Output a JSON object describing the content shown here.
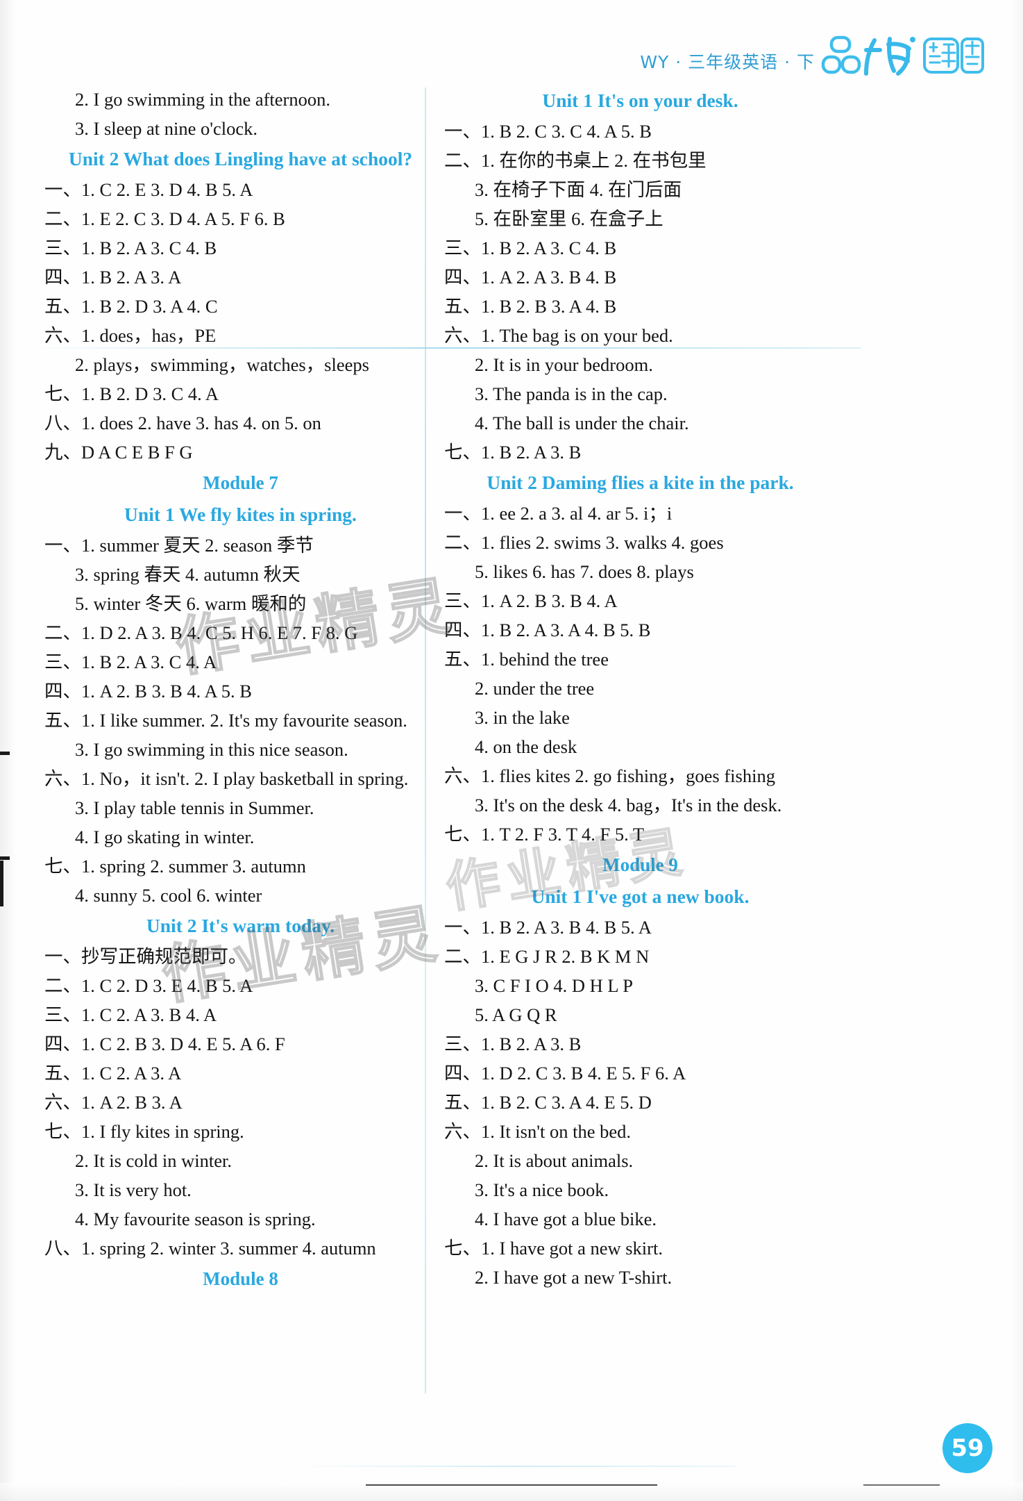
{
  "header": {
    "subject_line": "WY · 三年级英语 · 下",
    "logo_text": "品优课堂",
    "logo_part1": "品",
    "logo_part2": "优",
    "logo_part3": "课",
    "logo_part4": "堂",
    "accent_color": "#29a8e0"
  },
  "watermark": {
    "text": "作业精灵"
  },
  "page_number": "59",
  "left_column": [
    {
      "type": "answer",
      "indent": 1,
      "text": "2. I go swimming in the afternoon."
    },
    {
      "type": "answer",
      "indent": 1,
      "text": "3. I sleep at nine o'clock."
    },
    {
      "type": "unit",
      "text": "Unit 2    What does Lingling have at school?"
    },
    {
      "type": "answer",
      "indent": 0,
      "text": "一、1. C   2. E   3. D   4. B   5. A"
    },
    {
      "type": "answer",
      "indent": 0,
      "text": "二、1. E   2. C   3. D   4. A   5. F   6. B"
    },
    {
      "type": "answer",
      "indent": 0,
      "text": "三、1. B   2. A   3. C   4. B"
    },
    {
      "type": "answer",
      "indent": 0,
      "text": "四、1. B   2. A   3. A"
    },
    {
      "type": "answer",
      "indent": 0,
      "text": "五、1. B   2. D   3. A   4. C"
    },
    {
      "type": "answer",
      "indent": 0,
      "text": "六、1. does，has，PE"
    },
    {
      "type": "answer",
      "indent": 1,
      "text": "2. plays，swimming，watches，sleeps"
    },
    {
      "type": "answer",
      "indent": 0,
      "text": "七、1. B   2. D   3. C   4. A"
    },
    {
      "type": "answer",
      "indent": 0,
      "text": "八、1. does   2. have   3. has   4. on   5. on"
    },
    {
      "type": "answer",
      "indent": 0,
      "text": "九、D   A   C   E   B   F   G"
    },
    {
      "type": "module",
      "text": "Module 7"
    },
    {
      "type": "unit",
      "text": "Unit 1    We fly kites in spring."
    },
    {
      "type": "answer",
      "indent": 0,
      "text": "一、1. summer   夏天   2. season   季节"
    },
    {
      "type": "answer",
      "indent": 1,
      "text": "3. spring   春天   4. autumn   秋天"
    },
    {
      "type": "answer",
      "indent": 1,
      "text": "5. winter   冬天   6. warm   暖和的"
    },
    {
      "type": "answer",
      "indent": 0,
      "text": "二、1. D  2. A  3. B  4. C  5. H  6. E  7. F  8. G"
    },
    {
      "type": "answer",
      "indent": 0,
      "text": "三、1. B   2. A   3. C   4. A"
    },
    {
      "type": "answer",
      "indent": 0,
      "text": "四、1. A   2. B   3. B   4. A   5. B"
    },
    {
      "type": "answer",
      "indent": 0,
      "text": "五、1. I like summer.    2. It's my favourite season."
    },
    {
      "type": "answer",
      "indent": 1,
      "text": "3. I go swimming in this nice season."
    },
    {
      "type": "answer",
      "indent": 0,
      "text": "六、1. No，it isn't.    2. I play basketball in spring."
    },
    {
      "type": "answer",
      "indent": 1,
      "text": "3. I play table tennis in Summer."
    },
    {
      "type": "answer",
      "indent": 1,
      "text": "4. I go skating in winter."
    },
    {
      "type": "answer",
      "indent": 0,
      "text": "七、1. spring   2. summer   3. autumn"
    },
    {
      "type": "answer",
      "indent": 1,
      "text": "4. sunny   5. cool   6. winter"
    },
    {
      "type": "unit",
      "text": "Unit 2    It's warm today."
    },
    {
      "type": "answer",
      "indent": 0,
      "text": "一、抄写正确规范即可。"
    },
    {
      "type": "answer",
      "indent": 0,
      "text": "二、1. C   2. D   3. E   4. B   5. A"
    },
    {
      "type": "answer",
      "indent": 0,
      "text": "三、1. C   2. A   3. B   4. A"
    },
    {
      "type": "answer",
      "indent": 0,
      "text": "四、1. C   2. B   3. D   4. E   5. A   6. F"
    },
    {
      "type": "answer",
      "indent": 0,
      "text": "五、1. C   2. A   3. A"
    },
    {
      "type": "answer",
      "indent": 0,
      "text": "六、1. A   2. B   3. A"
    },
    {
      "type": "answer",
      "indent": 0,
      "text": "七、1. I fly kites in spring."
    },
    {
      "type": "answer",
      "indent": 1,
      "text": "2. It is cold in winter."
    },
    {
      "type": "answer",
      "indent": 1,
      "text": "3. It is very hot."
    },
    {
      "type": "answer",
      "indent": 1,
      "text": "4. My favourite season is spring."
    },
    {
      "type": "answer",
      "indent": 0,
      "text": "八、1. spring   2. winter   3. summer   4. autumn"
    },
    {
      "type": "module",
      "text": "Module 8"
    }
  ],
  "right_column": [
    {
      "type": "unit",
      "text": "Unit 1    It's on your desk."
    },
    {
      "type": "answer",
      "indent": 0,
      "text": "一、1. B   2. C   3. C   4. A   5. B"
    },
    {
      "type": "answer",
      "indent": 0,
      "text": "二、1. 在你的书桌上   2. 在书包里"
    },
    {
      "type": "answer",
      "indent": 1,
      "text": "3. 在椅子下面   4. 在门后面"
    },
    {
      "type": "answer",
      "indent": 1,
      "text": "5. 在卧室里   6. 在盒子上"
    },
    {
      "type": "answer",
      "indent": 0,
      "text": "三、1. B   2. A   3. C   4. B"
    },
    {
      "type": "answer",
      "indent": 0,
      "text": "四、1. A   2. A   3. B   4. B"
    },
    {
      "type": "answer",
      "indent": 0,
      "text": "五、1. B   2. B   3. A   4. B"
    },
    {
      "type": "answer",
      "indent": 0,
      "text": "六、1. The bag is on your bed."
    },
    {
      "type": "answer",
      "indent": 1,
      "text": "2. It is in your bedroom."
    },
    {
      "type": "answer",
      "indent": 1,
      "text": "3. The panda is in the cap."
    },
    {
      "type": "answer",
      "indent": 1,
      "text": "4. The ball is under the chair."
    },
    {
      "type": "answer",
      "indent": 0,
      "text": "七、1. B   2. A   3. B"
    },
    {
      "type": "unit",
      "text": "Unit 2    Daming flies a kite in the park."
    },
    {
      "type": "answer",
      "indent": 0,
      "text": "一、1. ee   2. a   3. al   4. ar   5. i；i"
    },
    {
      "type": "answer",
      "indent": 0,
      "text": "二、1. flies   2. swims   3. walks   4. goes"
    },
    {
      "type": "answer",
      "indent": 1,
      "text": "5. likes   6. has   7. does   8. plays"
    },
    {
      "type": "answer",
      "indent": 0,
      "text": "三、1. A   2. B   3. B   4. A"
    },
    {
      "type": "answer",
      "indent": 0,
      "text": "四、1. B   2. A   3. A   4. B   5. B"
    },
    {
      "type": "answer",
      "indent": 0,
      "text": "五、1. behind the tree"
    },
    {
      "type": "answer",
      "indent": 1,
      "text": "2. under the tree"
    },
    {
      "type": "answer",
      "indent": 1,
      "text": "3. in the lake"
    },
    {
      "type": "answer",
      "indent": 1,
      "text": "4. on the desk"
    },
    {
      "type": "answer",
      "indent": 0,
      "text": "六、1. flies kites   2. go fishing，goes fishing"
    },
    {
      "type": "answer",
      "indent": 1,
      "text": "3. It's on the desk   4. bag，It's in the desk."
    },
    {
      "type": "answer",
      "indent": 0,
      "text": "七、1. T   2. F   3. T   4. F   5. T"
    },
    {
      "type": "module",
      "text": "Module 9"
    },
    {
      "type": "unit",
      "text": "Unit 1    I've got a new book."
    },
    {
      "type": "answer",
      "indent": 0,
      "text": "一、1. B   2. A   3. B   4. B   5. A"
    },
    {
      "type": "answer",
      "indent": 0,
      "text": "二、1. E   G   J   R   2. B   K   M   N"
    },
    {
      "type": "answer",
      "indent": 1,
      "text": "3. C   F   I   O   4. D   H   L   P"
    },
    {
      "type": "answer",
      "indent": 1,
      "text": "5. A   G   Q   R"
    },
    {
      "type": "answer",
      "indent": 0,
      "text": "三、1. B   2. A   3. B"
    },
    {
      "type": "answer",
      "indent": 0,
      "text": "四、1. D   2. C   3. B   4. E   5. F   6. A"
    },
    {
      "type": "answer",
      "indent": 0,
      "text": "五、1. B   2. C   3. A   4. E   5. D"
    },
    {
      "type": "answer",
      "indent": 0,
      "text": "六、1. It isn't on the bed."
    },
    {
      "type": "answer",
      "indent": 1,
      "text": "2. It is about animals."
    },
    {
      "type": "answer",
      "indent": 1,
      "text": "3. It's a nice book."
    },
    {
      "type": "answer",
      "indent": 1,
      "text": "4. I have got a blue bike."
    },
    {
      "type": "answer",
      "indent": 0,
      "text": "七、1. I have got a new skirt."
    },
    {
      "type": "answer",
      "indent": 1,
      "text": "2. I have got a new T-shirt."
    }
  ]
}
